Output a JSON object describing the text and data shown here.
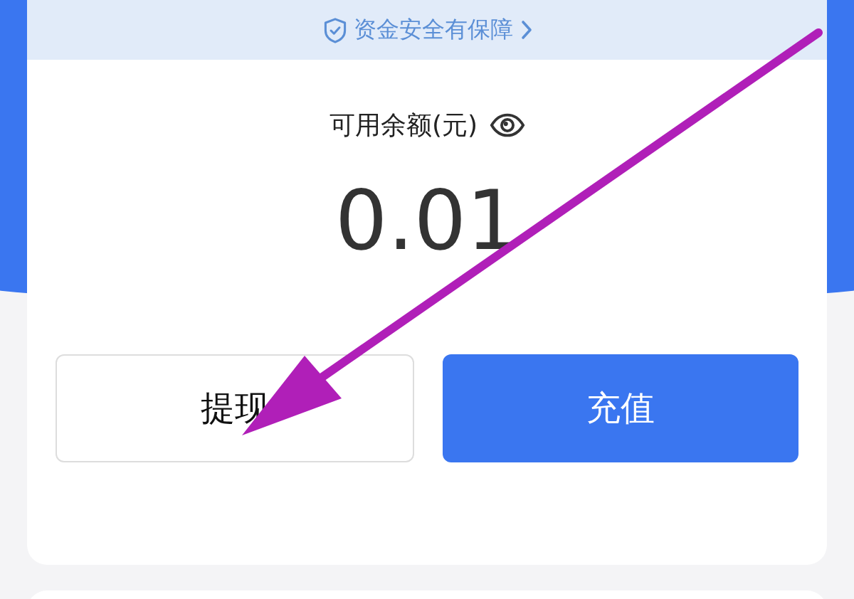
{
  "security_banner": {
    "text": "资金安全有保障"
  },
  "balance": {
    "label": "可用余额(元)",
    "amount": "0.01"
  },
  "buttons": [
    {
      "label": "提现",
      "kind": "secondary"
    },
    {
      "label": "充值",
      "kind": "primary"
    }
  ]
}
